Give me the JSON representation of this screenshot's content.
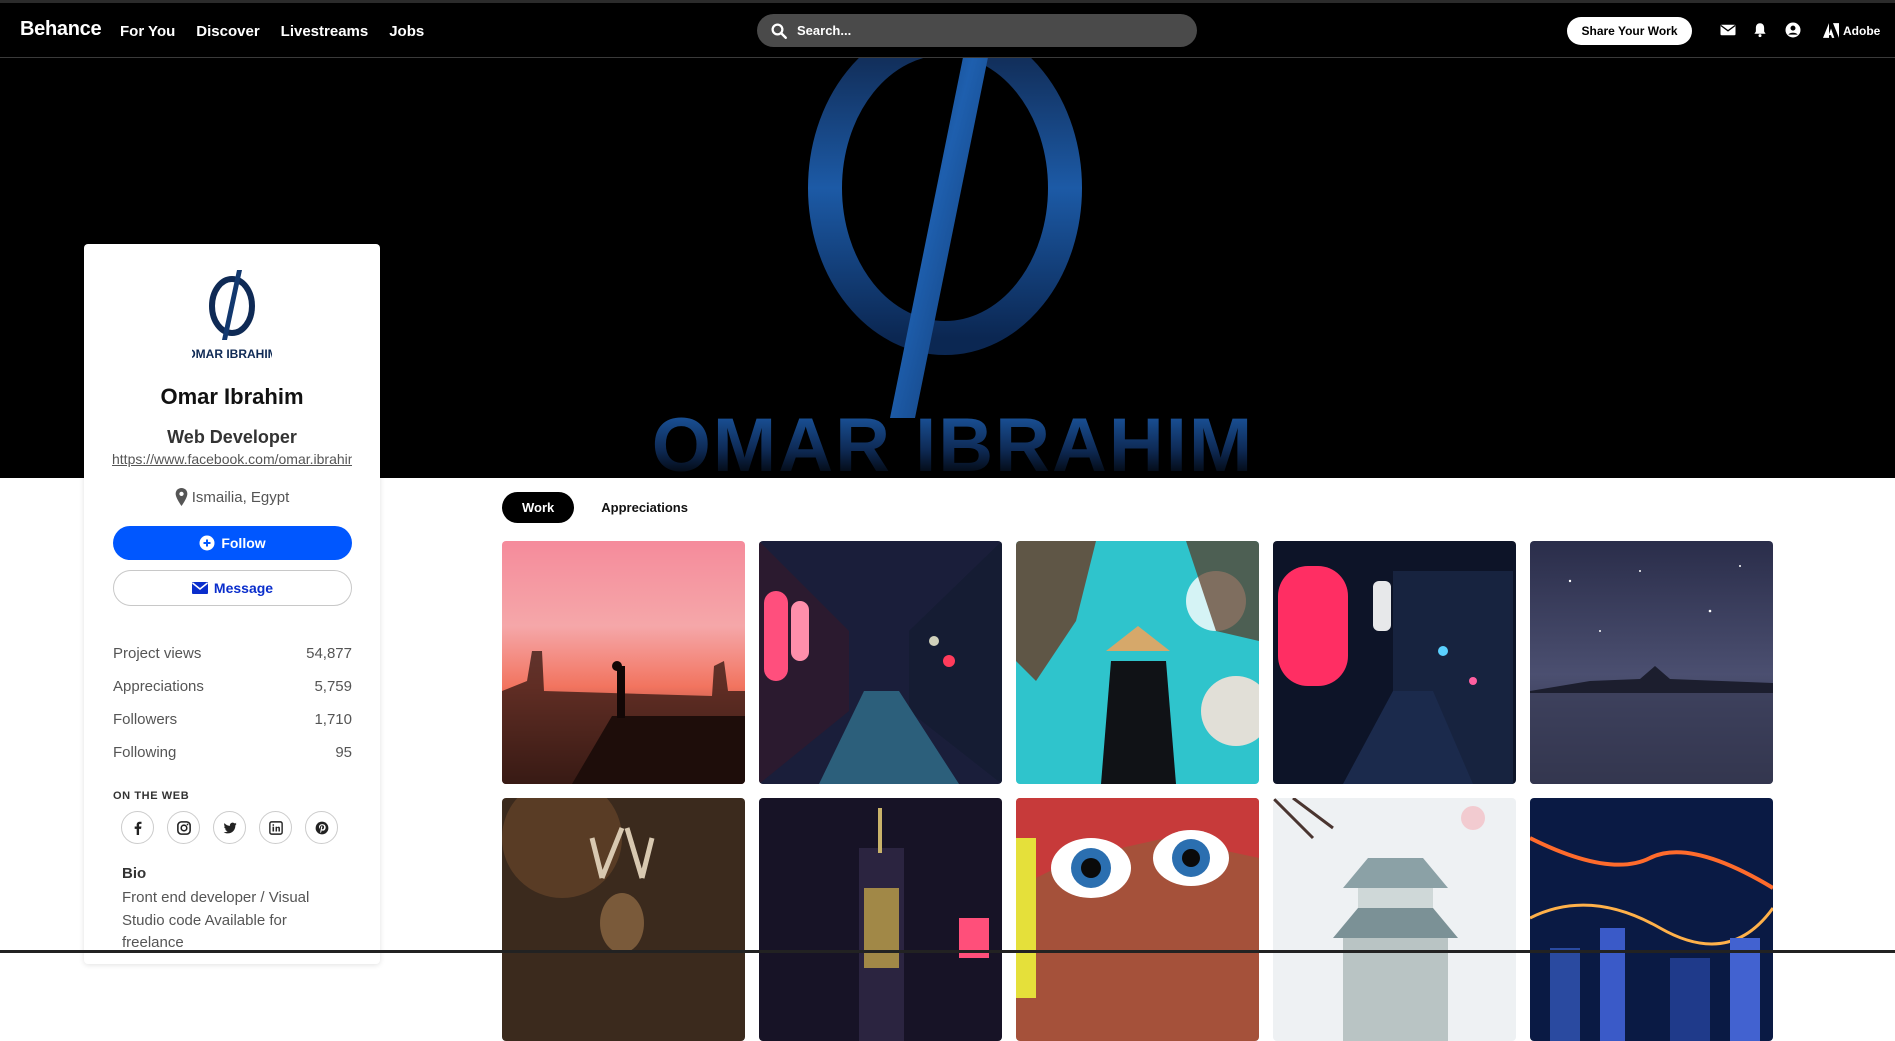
{
  "nav": {
    "brand": "Behance",
    "links": [
      "For You",
      "Discover",
      "Livestreams",
      "Jobs"
    ],
    "search_placeholder": "Search...",
    "share_label": "Share Your Work",
    "adobe_label": "Adobe",
    "icons": [
      "search-icon",
      "mail-icon",
      "bell-icon",
      "account-icon",
      "adobe-logo-icon"
    ]
  },
  "banner": {
    "name_text": "OMAR IBRAHIM",
    "logo_glyph": "ϕ"
  },
  "profile": {
    "avatar_caption": "OMAR IBRAHIM",
    "name": "Omar Ibrahim",
    "occupation": "Web Developer",
    "website": "https://www.facebook.com/omar.ibrahim",
    "location": "Ismailia, Egypt",
    "follow_label": "Follow",
    "message_label": "Message",
    "stats": [
      {
        "label": "Project views",
        "value": "54,877"
      },
      {
        "label": "Appreciations",
        "value": "5,759"
      },
      {
        "label": "Followers",
        "value": "1,710"
      },
      {
        "label": "Following",
        "value": "95"
      }
    ],
    "on_the_web_label": "ON THE WEB",
    "socials": [
      "facebook",
      "instagram",
      "twitter",
      "linkedin",
      "pinterest"
    ],
    "bio_heading": "Bio",
    "bio_text": "Front end developer / Visual Studio code Available for freelance"
  },
  "tabs": [
    {
      "label": "Work",
      "active": true
    },
    {
      "label": "Appreciations",
      "active": false
    }
  ],
  "colors": {
    "accent_blue": "#0057ff",
    "message_blue": "#0a2ecc",
    "banner_logo_blue": "#1c5aa6"
  }
}
